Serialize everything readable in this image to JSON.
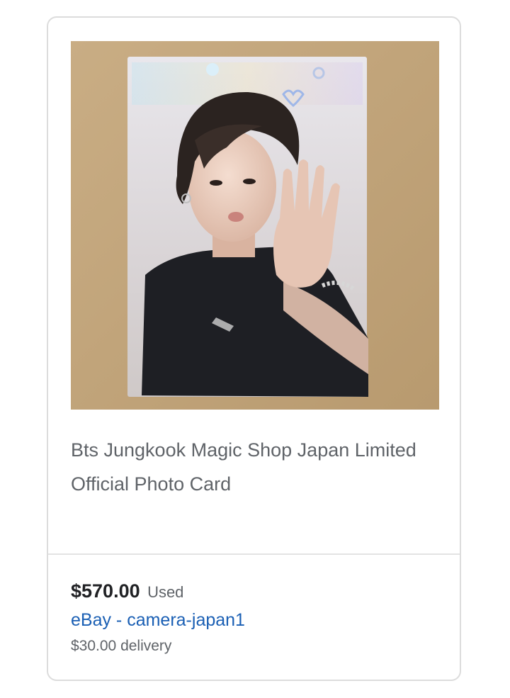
{
  "listing": {
    "image_alt": "BTS Jungkook photo card",
    "title": "Bts Jungkook Magic Shop Japan Limited Official Photo Card",
    "price": "$570.00",
    "condition": "Used",
    "seller": "eBay - camera-japan1",
    "delivery": "$30.00 delivery"
  },
  "colors": {
    "price": "#202124",
    "seller_link": "#1a5fb4",
    "secondary_text": "#5f6368",
    "card_border": "#dcdcdc"
  }
}
